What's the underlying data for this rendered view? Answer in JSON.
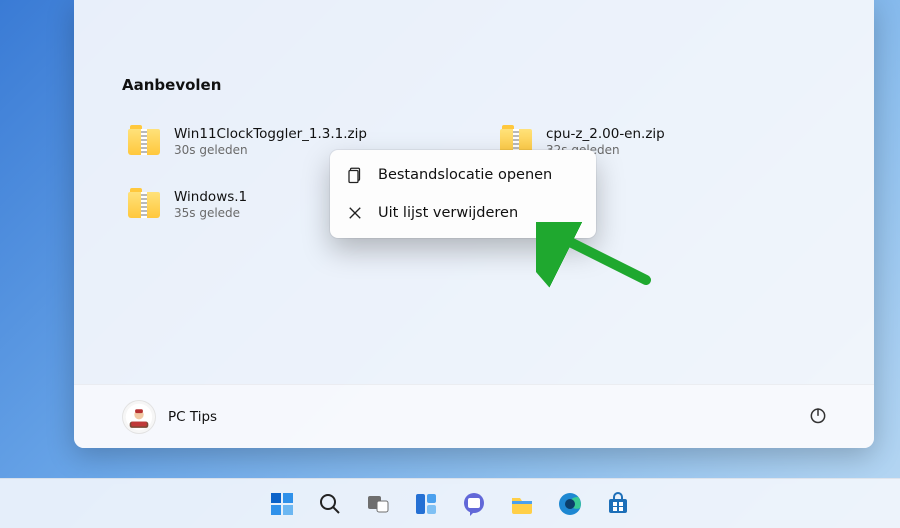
{
  "section_title": "Aanbevolen",
  "recommended": [
    {
      "name": "Win11ClockToggler_1.3.1.zip",
      "time": "30s geleden"
    },
    {
      "name": "cpu-z_2.00-en.zip",
      "time": "32s geleden"
    },
    {
      "name": "Windows.1",
      "time": "35s gelede"
    }
  ],
  "context_menu": {
    "open_location": "Bestandslocatie openen",
    "remove_from_list": "Uit lijst verwijderen"
  },
  "footer": {
    "user_name": "PC Tips"
  },
  "taskbar": {
    "items": [
      "start",
      "search",
      "task-view",
      "widgets",
      "chat",
      "explorer",
      "edge",
      "store"
    ]
  },
  "colors": {
    "arrow": "#1fa82f"
  }
}
